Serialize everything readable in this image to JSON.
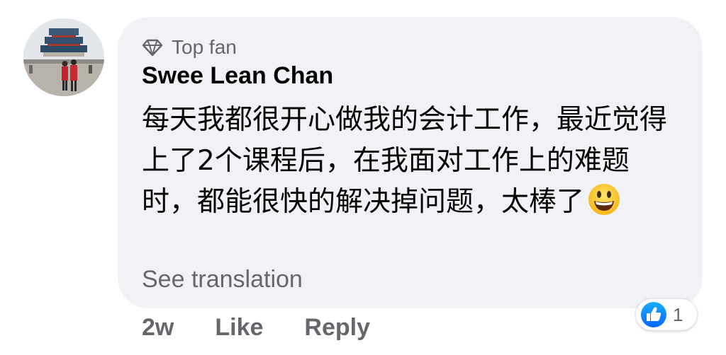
{
  "comment": {
    "badge_label": "Top fan",
    "badge_icon": "diamond-icon",
    "author": "Swee Lean Chan",
    "text": "每天我都很开心做我的会计工作，最近觉得上了2个课程后，在我面对工作上的难题时，都能很快的解决掉问题，太棒了",
    "emoji": "grinning-face-emoji",
    "see_translation": "See translation",
    "timestamp": "2w",
    "like_label": "Like",
    "reply_label": "Reply",
    "reaction": {
      "icon": "thumbs-up-icon",
      "count": "1"
    }
  },
  "colors": {
    "bubble_bg": "#f0f2f5",
    "secondary_text": "#65676b",
    "primary_text": "#050505",
    "like_blue": "#1877f2"
  }
}
